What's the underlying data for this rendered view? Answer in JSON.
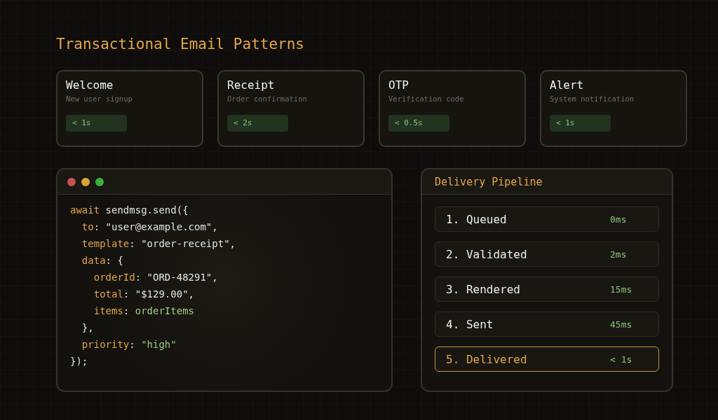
{
  "title": "Transactional Email Patterns",
  "cards": [
    {
      "name": "Welcome",
      "description": "New user signup",
      "timing": "< 1s"
    },
    {
      "name": "Receipt",
      "description": "Order confirmation",
      "timing": "< 2s"
    },
    {
      "name": "OTP",
      "description": "Verification code",
      "timing": "< 0.5s"
    },
    {
      "name": "Alert",
      "description": "System notification",
      "timing": "< 1s"
    }
  ],
  "code_window": {
    "lines": [
      {
        "tokens": [
          {
            "kind": "keyword",
            "text": "await"
          },
          {
            "kind": "plain",
            "text": " sendmsg.send({"
          }
        ],
        "children": [
          {
            "tokens": [
              {
                "kind": "keyword",
                "text": "to"
              },
              {
                "kind": "plain",
                "text": ": \"user@example.com\","
              }
            ]
          },
          {
            "tokens": [
              {
                "kind": "keyword",
                "text": "template"
              },
              {
                "kind": "plain",
                "text": ": \"order-receipt\","
              }
            ]
          },
          {
            "tokens": [
              {
                "kind": "keyword",
                "text": "data"
              },
              {
                "kind": "plain",
                "text": ": {"
              }
            ],
            "children": [
              {
                "tokens": [
                  {
                    "kind": "keyword",
                    "text": "orderId"
                  },
                  {
                    "kind": "plain",
                    "text": ": \"ORD-48291\","
                  }
                ]
              },
              {
                "tokens": [
                  {
                    "kind": "keyword",
                    "text": "total"
                  },
                  {
                    "kind": "plain",
                    "text": ": \"$129.00\","
                  }
                ]
              },
              {
                "tokens": [
                  {
                    "kind": "keyword",
                    "text": "items"
                  },
                  {
                    "kind": "plain",
                    "text": ": "
                  },
                  {
                    "kind": "value",
                    "text": "orderItems"
                  }
                ]
              }
            ]
          },
          {
            "tokens": [
              {
                "kind": "plain",
                "text": "},"
              }
            ]
          },
          {
            "tokens": [
              {
                "kind": "keyword",
                "text": "priority"
              },
              {
                "kind": "plain",
                "text": ": "
              },
              {
                "kind": "value",
                "text": "\"high\""
              }
            ]
          }
        ]
      },
      {
        "tokens": [
          {
            "kind": "plain",
            "text": "});"
          }
        ]
      }
    ]
  },
  "pipeline": {
    "title": "Delivery Pipeline",
    "steps": [
      {
        "label": "1. Queued",
        "time": "0ms",
        "selected": false
      },
      {
        "label": "2. Validated",
        "time": "2ms",
        "selected": false
      },
      {
        "label": "3. Rendered",
        "time": "15ms",
        "selected": false
      },
      {
        "label": "4. Sent",
        "time": "45ms",
        "selected": false
      },
      {
        "label": "5. Delivered",
        "time": "< 1s",
        "selected": true
      }
    ]
  }
}
